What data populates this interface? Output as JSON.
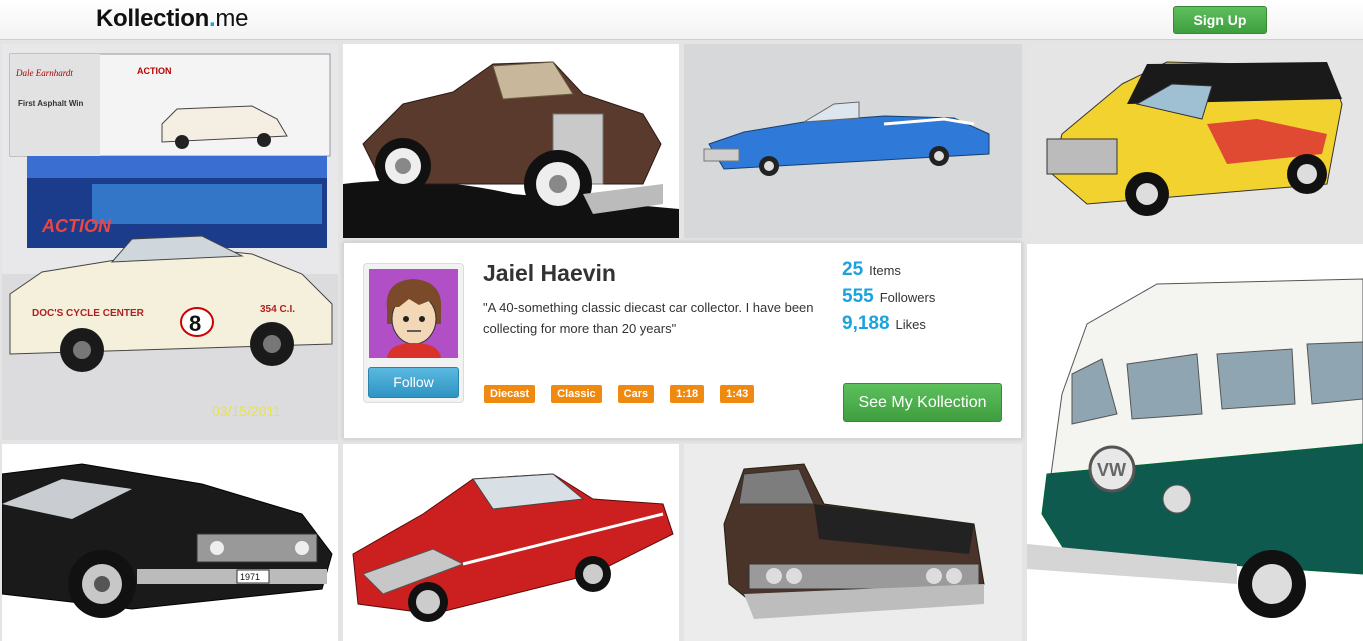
{
  "header": {
    "logo_main": "Kollection",
    "logo_dot": ".",
    "logo_tld": "me",
    "signup_label": "Sign Up"
  },
  "profile": {
    "name": "Jaiel Haevin",
    "bio": "\"A 40-something classic diecast car collector. I have been collecting for more than 20 years\"",
    "follow_label": "Follow",
    "see_kollection_label": "See My Kollection",
    "tags": [
      "Diecast",
      "Classic",
      "Cars",
      "1:18",
      "1:43"
    ],
    "stats": [
      {
        "value": "25",
        "label": "Items"
      },
      {
        "value": "555",
        "label": "Followers"
      },
      {
        "value": "9,188",
        "label": "Likes"
      }
    ]
  },
  "photos": {
    "box_text_1": "First Asphalt Win",
    "box_brand": "ACTION",
    "car_sign": "DOC'S CYCLE CENTER",
    "car_number": "8",
    "car_engine": "354 C.I.",
    "date_stamp": "03/15/2011",
    "plate_1971": "1971"
  },
  "colors": {
    "accent_blue": "#1aa3dd",
    "green_button": "#4aae4a",
    "tag_orange": "#f0890f",
    "follow_blue": "#3ea4d1"
  }
}
